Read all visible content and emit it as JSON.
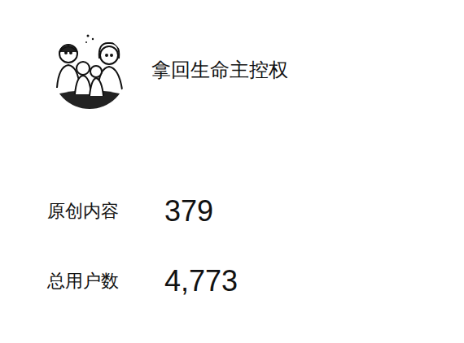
{
  "profile": {
    "name": "拿回生命主控权"
  },
  "stats": [
    {
      "label": "原创内容",
      "value": "379"
    },
    {
      "label": "总用户数",
      "value": "4,773"
    }
  ]
}
